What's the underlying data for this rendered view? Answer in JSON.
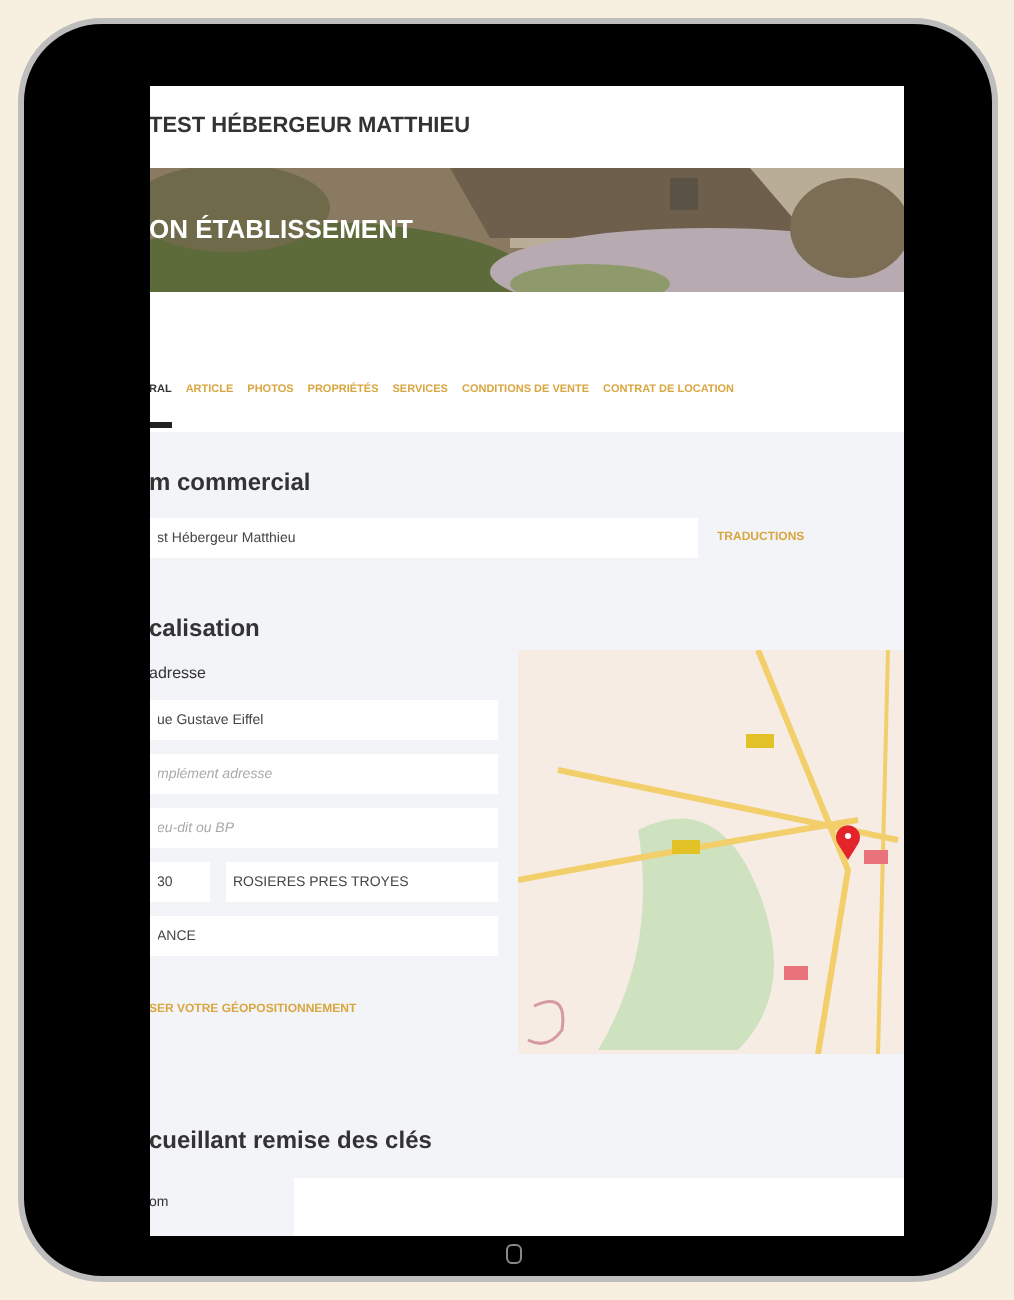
{
  "header": {
    "title": "TEST HÉBERGEUR MATTHIEU"
  },
  "hero": {
    "title": "ON ÉTABLISSEMENT"
  },
  "tabs": [
    {
      "label": "RAL",
      "selected": true
    },
    {
      "label": "ARTICLE",
      "selected": false
    },
    {
      "label": "PHOTOS",
      "selected": false
    },
    {
      "label": "PROPRIÉTÉS",
      "selected": false
    },
    {
      "label": "SERVICES",
      "selected": false
    },
    {
      "label": "CONDITIONS DE VENTE",
      "selected": false
    },
    {
      "label": "CONTRAT DE LOCATION",
      "selected": false
    }
  ],
  "commercial": {
    "heading": "m commercial",
    "value": "st Hébergeur Matthieu",
    "link": "TRADUCTIONS"
  },
  "localisation": {
    "heading": "calisation",
    "label": "adresse",
    "street": {
      "value": "ue Gustave Eiffel"
    },
    "complement": {
      "placeholder": "mplément adresse"
    },
    "lieu_dit": {
      "placeholder": "eu-dit ou BP"
    },
    "postcode": {
      "value": "30"
    },
    "city": {
      "value": "ROSIERES PRES TROYES"
    },
    "country": {
      "value": "ANCE"
    },
    "link": "SER VOTRE GÉOPOSITIONNEMENT"
  },
  "keys": {
    "heading": "cueillant remise des clés",
    "label": "om"
  }
}
